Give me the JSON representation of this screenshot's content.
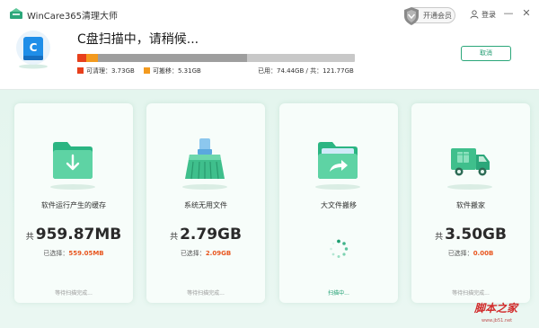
{
  "app": {
    "title": "WinCare365清理大师"
  },
  "header": {
    "vip_label": "开通会员",
    "login_label": "登录",
    "minimize": "—",
    "close": "✕"
  },
  "scan": {
    "drive_letter": "C",
    "title": "C盘扫描中，请稍候...",
    "cleanable_label": "可清理：3.73GB",
    "movable_label": "可搬移：5.31GB",
    "usage_label": "已用：74.44GB / 共：121.77GB",
    "cancel_label": "取消",
    "cleanable_fraction": 0.031,
    "movable_fraction": 0.044,
    "used_fraction": 0.611,
    "colors": {
      "cleanable": "#e8401c",
      "movable": "#f39a1e",
      "used": "#c8c8c8"
    }
  },
  "cards": [
    {
      "name": "软件运行产生的缓存",
      "prefix": "共",
      "size": "959.87MB",
      "selected_label": "已选择：",
      "selected_value": "559.05MB",
      "status": "等待扫描完成..."
    },
    {
      "name": "系统无用文件",
      "prefix": "共",
      "size": "2.79GB",
      "selected_label": "已选择：",
      "selected_value": "2.09GB",
      "status": "等待扫描完成..."
    },
    {
      "name": "大文件搬移",
      "status": "扫描中..."
    },
    {
      "name": "软件搬家",
      "prefix": "共",
      "size": "3.50GB",
      "selected_label": "已选择：",
      "selected_value": "0.00B",
      "status": "等待扫描完成..."
    }
  ],
  "watermark": {
    "text": "脚本之家",
    "url": "www.jb51.net"
  },
  "theme": {
    "accent": "#2ba77a",
    "highlight": "#e8561f"
  }
}
